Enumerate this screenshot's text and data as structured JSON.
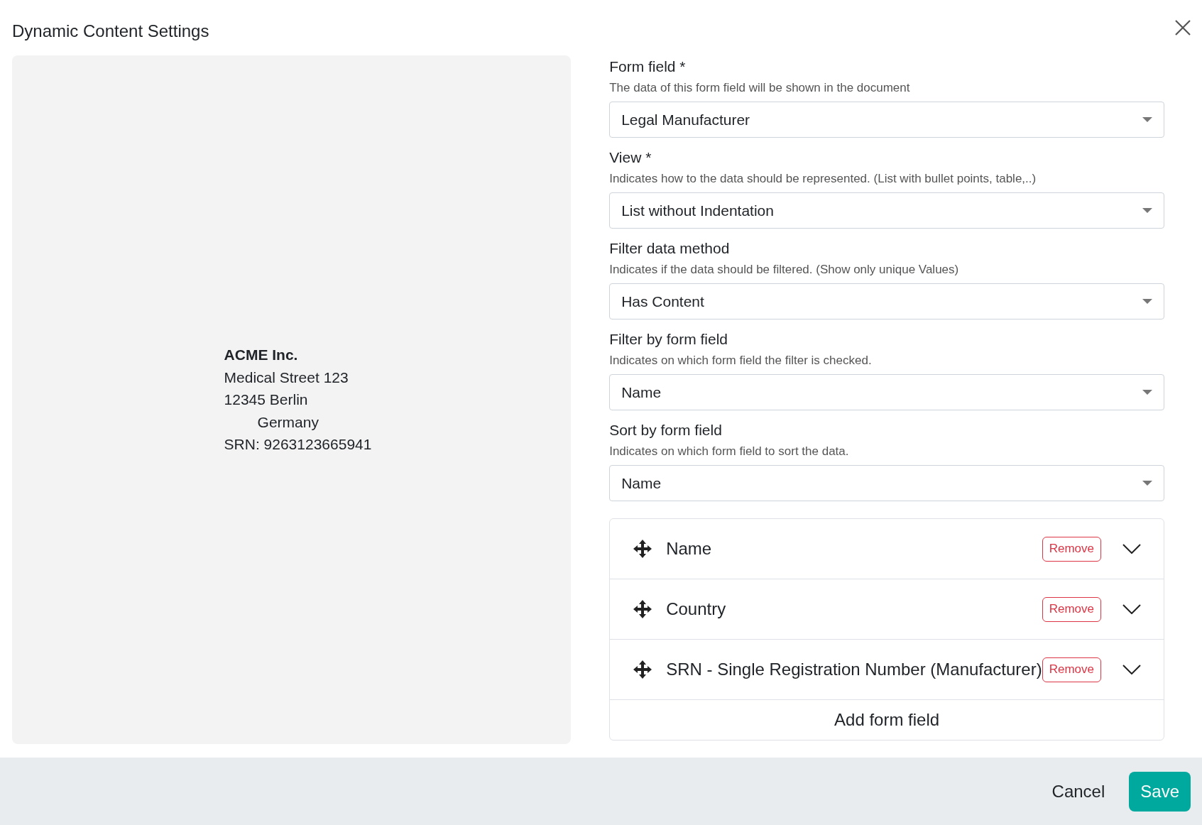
{
  "dialog": {
    "title": "Dynamic Content Settings"
  },
  "preview": {
    "lines": [
      {
        "text": "ACME Inc.",
        "bold": true,
        "indented": false
      },
      {
        "text": "Medical Street 123",
        "bold": false,
        "indented": false
      },
      {
        "text": "12345 Berlin",
        "bold": false,
        "indented": false
      },
      {
        "text": "Germany",
        "bold": false,
        "indented": true
      },
      {
        "text": "SRN: 9263123665941",
        "bold": false,
        "indented": false
      }
    ]
  },
  "settings": [
    {
      "label": "Form field *",
      "description": "The data of this form field will be shown in the document",
      "value": "Legal Manufacturer"
    },
    {
      "label": "View *",
      "description": "Indicates how to the data should be represented. (List with bullet points, table,..)",
      "value": "List without Indentation"
    },
    {
      "label": "Filter data method",
      "description": "Indicates if the data should be filtered. (Show only unique Values)",
      "value": "Has Content"
    },
    {
      "label": "Filter by form field",
      "description": "Indicates on which form field the filter is checked.",
      "value": "Name"
    },
    {
      "label": "Sort by form field",
      "description": "Indicates on which form field to sort the data.",
      "value": "Name"
    }
  ],
  "form_fields": [
    {
      "name": "Name",
      "remove": "Remove"
    },
    {
      "name": "Country",
      "remove": "Remove"
    },
    {
      "name": "SRN - Single Registration Number (Manufacturer)",
      "remove": "Remove"
    }
  ],
  "add_button": "Add form field",
  "footer": {
    "cancel": "Cancel",
    "save": "Save"
  }
}
